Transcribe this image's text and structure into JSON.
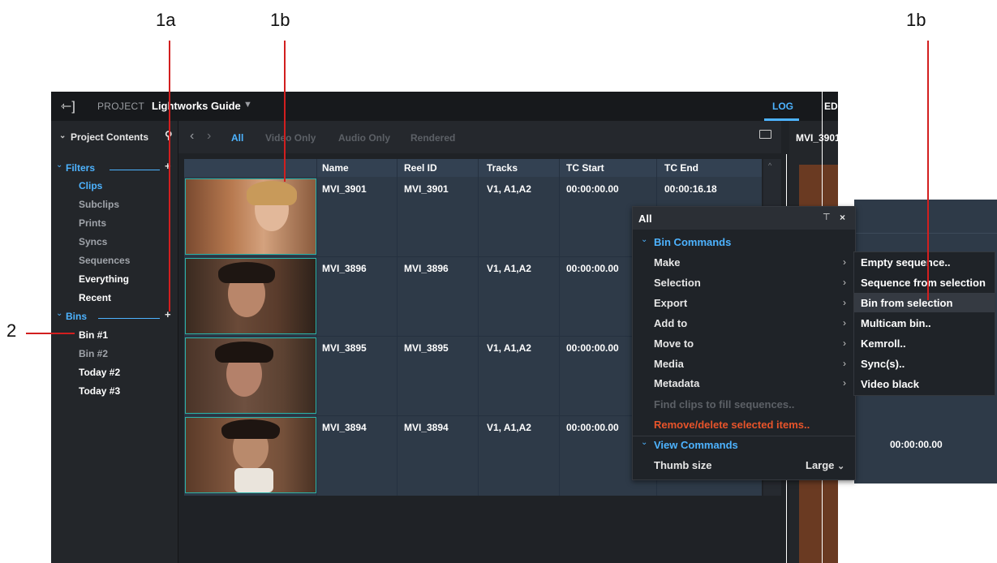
{
  "callouts": {
    "label_1a": "1a",
    "label_1b_left": "1b",
    "label_1b_right": "1b",
    "label_2": "2"
  },
  "topbar": {
    "project_prefix": "PROJECT",
    "project_name": "Lightworks Guide",
    "tab_log": "LOG",
    "tab_edit": "EDIT",
    "accent": "#4db3ff"
  },
  "left_panel": {
    "header": "Project Contents",
    "filters_label": "Filters",
    "filters": [
      "Clips",
      "Subclips",
      "Prints",
      "Syncs",
      "Sequences",
      "Everything",
      "Recent"
    ],
    "bins_label": "Bins",
    "bins": [
      "Bin #1",
      "Bin #2",
      "Today #2",
      "Today #3"
    ]
  },
  "filter_bar": {
    "options": [
      "All",
      "Video Only",
      "Audio Only",
      "Rendered"
    ]
  },
  "table": {
    "columns": [
      "Name",
      "Reel ID",
      "Tracks",
      "TC Start",
      "TC End"
    ],
    "rows": [
      {
        "name": "MVI_3901",
        "reel": "MVI_3901",
        "tracks": "V1, A1,A2",
        "tc_start": "00:00:00.00",
        "tc_end": "00:00:16.18"
      },
      {
        "name": "MVI_3896",
        "reel": "MVI_3896",
        "tracks": "V1, A1,A2",
        "tc_start": "00:00:00.00",
        "tc_end": ""
      },
      {
        "name": "MVI_3895",
        "reel": "MVI_3895",
        "tracks": "V1, A1,A2",
        "tc_start": "00:00:00.00",
        "tc_end": ""
      },
      {
        "name": "MVI_3894",
        "reel": "MVI_3894",
        "tracks": "V1, A1,A2",
        "tc_start": "00:00:00.00",
        "tc_end": ""
      }
    ]
  },
  "viewer": {
    "clip_name": "MVI_3901"
  },
  "menu": {
    "title": "All",
    "bin_commands": "Bin Commands",
    "items": [
      "Make",
      "Selection",
      "Export",
      "Add to",
      "Move to",
      "Media",
      "Metadata"
    ],
    "disabled_item": "Find clips to fill sequences..",
    "danger_item": "Remove/delete selected items..",
    "view_commands": "View Commands",
    "thumb_size_label": "Thumb size",
    "thumb_size_value": "Large",
    "danger_color": "#e8542a"
  },
  "submenu": {
    "items": [
      "Empty sequence..",
      "Sequence from selection",
      "Bin from selection",
      "Multicam bin..",
      "Kemroll..",
      "Sync(s)..",
      "Video black"
    ],
    "highlighted": "Bin from selection"
  },
  "overlay": {
    "tc_value": "00:00:00.00"
  }
}
